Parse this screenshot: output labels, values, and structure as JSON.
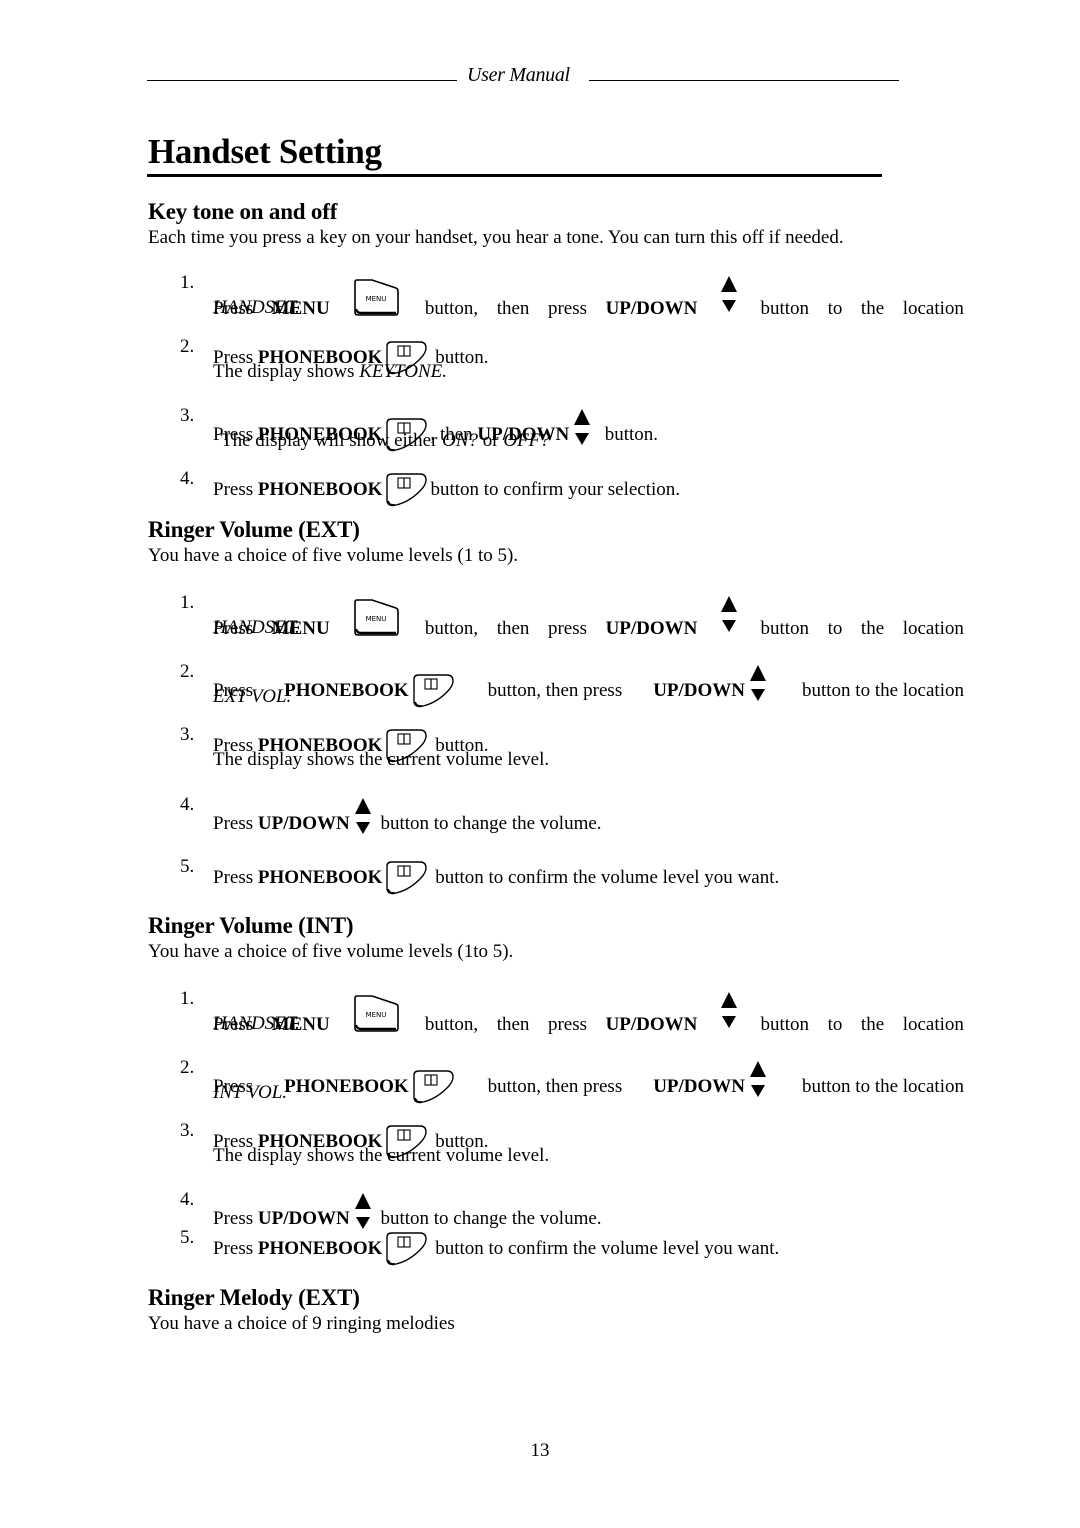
{
  "header": {
    "running_title": "User Manual"
  },
  "title": "Handset Setting",
  "sections": [
    {
      "heading": "Key tone on and off",
      "intro": "Each time you press a key on your handset, you hear a tone. You can turn this off if needed.",
      "steps": [
        {
          "num": "1.",
          "press": "Press",
          "button1": "MENU",
          "mid": "button, then press",
          "button2": "UP/DOWN",
          "tail": "button to the location",
          "result_italic": "HANDSET."
        },
        {
          "num": "2.",
          "press": "Press",
          "button1": "PHONEBOOK",
          "tail": "button.",
          "result_prefix": "The display shows",
          "result_italic": "KEYTONE."
        },
        {
          "num": "3.",
          "press": "Press",
          "button1": "PHONEBOOK",
          "mid": ", then",
          "button2": "UP/DOWN",
          "tail": "button.",
          "result_prefix": "The display will show either",
          "result_italic_1": "ON?",
          "result_or": "or",
          "result_italic_2": "OFF?"
        },
        {
          "num": "4.",
          "press": "Press",
          "button1": "PHONEBOOK",
          "tail": "button to confirm your selection."
        }
      ]
    },
    {
      "heading": "Ringer Volume (EXT)",
      "intro": "You have a choice of five volume levels (1 to 5).",
      "steps": [
        {
          "num": "1.",
          "press": "Press",
          "button1": "MENU",
          "mid": "button, then press",
          "button2": "UP/DOWN",
          "tail": "button to the location",
          "result_italic": "HANDSET."
        },
        {
          "num": "2.",
          "press": "Press",
          "button1": "PHONEBOOK",
          "mid": "button, then press",
          "button2": "UP/DOWN",
          "tail": "button to the location",
          "result_italic": "EXT VOL."
        },
        {
          "num": "3.",
          "press": "Press",
          "button1": "PHONEBOOK",
          "tail": "button.",
          "result_prefix": "The display shows the current volume level."
        },
        {
          "num": "4.",
          "press": "Press",
          "button1": "UP/DOWN",
          "tail": "button to change the volume."
        },
        {
          "num": "5.",
          "press": "Press",
          "button1": "PHONEBOOK",
          "tail": "button to confirm the volume level you want."
        }
      ]
    },
    {
      "heading": "Ringer Volume (INT)",
      "intro": "You have a choice of five volume levels (1to 5).",
      "steps": [
        {
          "num": "1.",
          "press": "Press",
          "button1": "MENU",
          "mid": "button, then press",
          "button2": "UP/DOWN",
          "tail": "button to the location",
          "result_italic": "HANDSET."
        },
        {
          "num": "2.",
          "press": "Press",
          "button1": "PHONEBOOK",
          "mid": "button, then press",
          "button2": "UP/DOWN",
          "tail": "button to the location",
          "result_italic": "INT VOL."
        },
        {
          "num": "3.",
          "press": "Press",
          "button1": "PHONEBOOK",
          "tail": "button.",
          "result_prefix": "The display shows the current volume level."
        },
        {
          "num": "4.",
          "press": "Press",
          "button1": "UP/DOWN",
          "tail": "button to change the volume."
        },
        {
          "num": "5.",
          "press": "Press",
          "button1": "PHONEBOOK",
          "tail": "button to confirm the volume level you want."
        }
      ]
    },
    {
      "heading": "Ringer Melody (EXT)",
      "intro": "You have a choice of 9 ringing melodies"
    }
  ],
  "icons": {
    "menu": {
      "name": "menu-key-icon",
      "label": "MENU"
    },
    "phonebook": {
      "name": "phonebook-key-icon"
    },
    "updown": {
      "name": "up-down-arrows-icon"
    }
  },
  "footer": {
    "page_number": "13"
  }
}
